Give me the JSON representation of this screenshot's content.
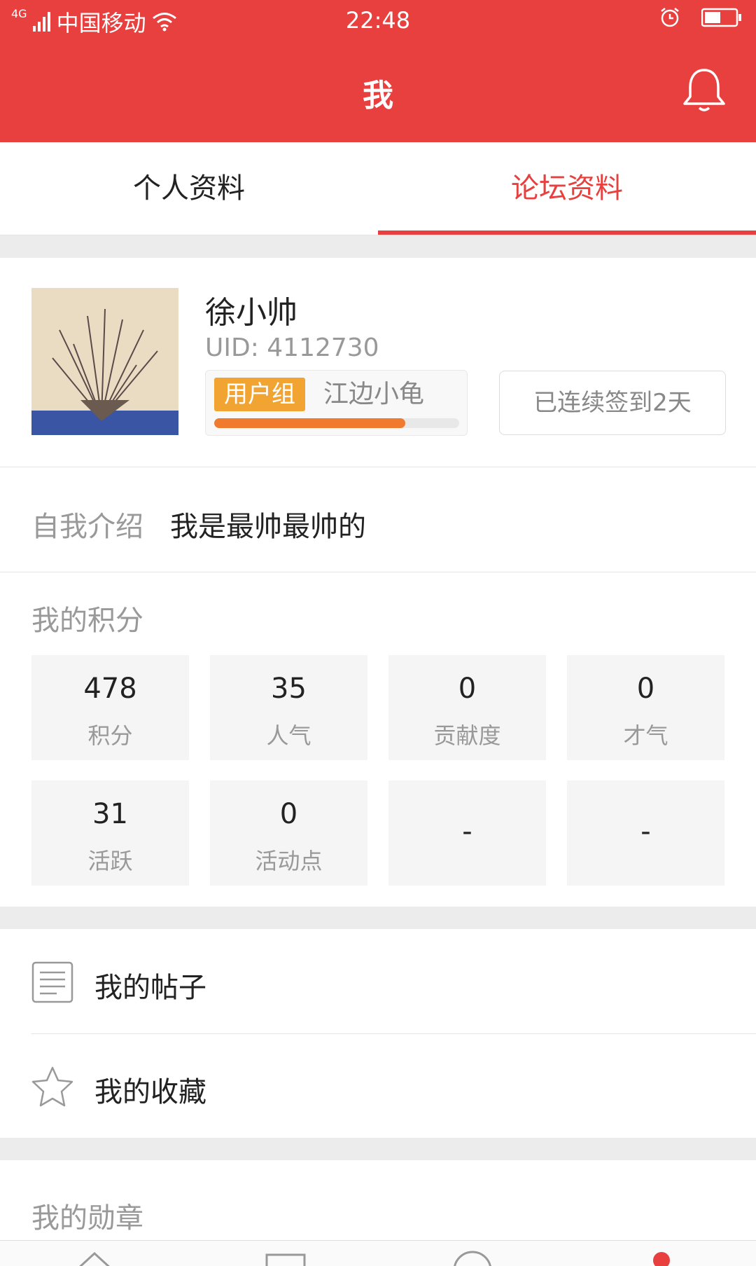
{
  "status_bar": {
    "network": "4G",
    "carrier": "中国移动",
    "time": "22:48"
  },
  "header": {
    "title": "我"
  },
  "tabs": [
    {
      "label": "个人资料",
      "active": false
    },
    {
      "label": "论坛资料",
      "active": true
    }
  ],
  "profile": {
    "name": "徐小帅",
    "uid": "UID: 4112730",
    "group_badge": "用户组",
    "group_name": "江边小龟",
    "progress": 0.78,
    "checkin": "已连续签到2天"
  },
  "intro": {
    "label": "自我介绍",
    "value": "我是最帅最帅的"
  },
  "points": {
    "heading": "我的积分",
    "items": [
      {
        "value": "478",
        "label": "积分"
      },
      {
        "value": "35",
        "label": "人气"
      },
      {
        "value": "0",
        "label": "贡献度"
      },
      {
        "value": "0",
        "label": "才气"
      },
      {
        "value": "31",
        "label": "活跃"
      },
      {
        "value": "0",
        "label": "活动点"
      },
      {
        "value": "-",
        "label": ""
      },
      {
        "value": "-",
        "label": ""
      }
    ]
  },
  "menu": [
    {
      "label": "我的帖子",
      "icon": "document-icon"
    },
    {
      "label": "我的收藏",
      "icon": "star-icon"
    }
  ],
  "medal": {
    "heading": "我的勋章"
  },
  "colors": {
    "brand": "#e8403e",
    "badge": "#f2a432",
    "progress": "#f07a2d"
  }
}
